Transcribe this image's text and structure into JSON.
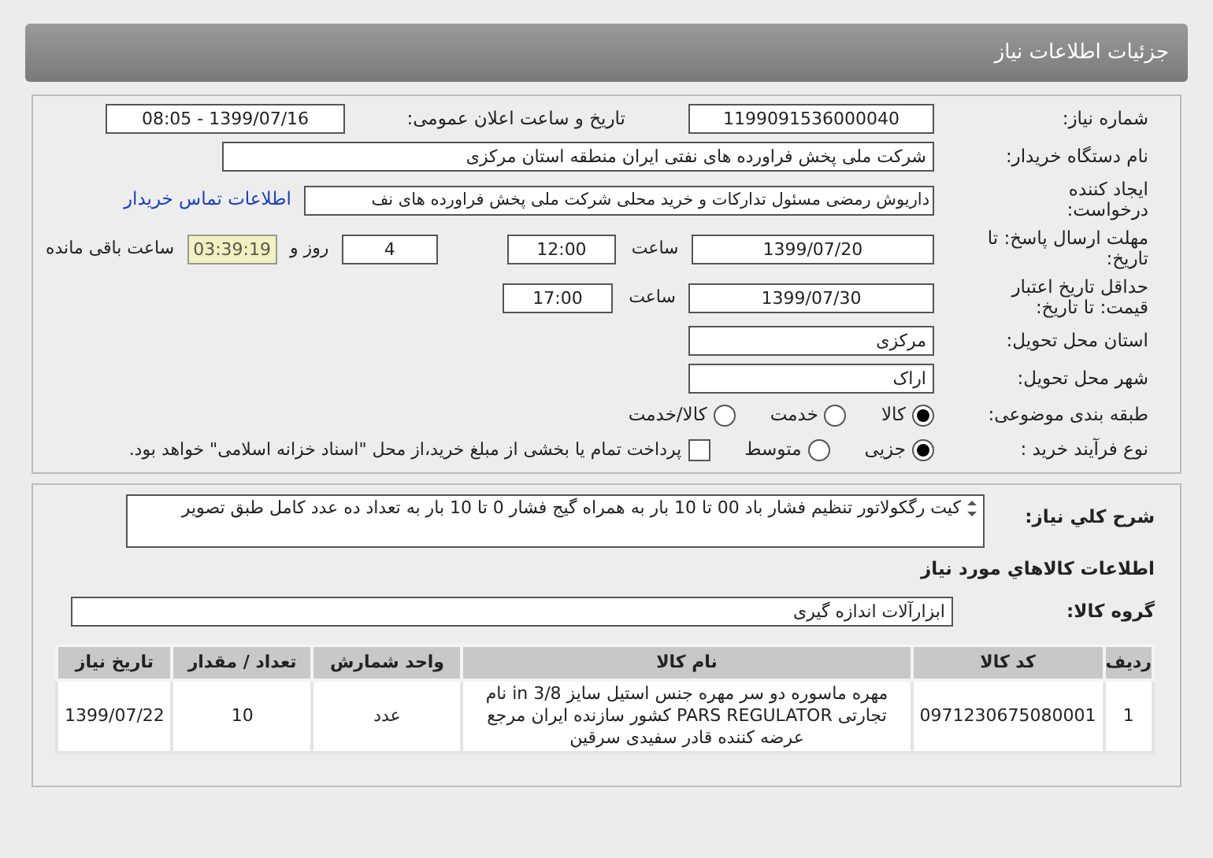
{
  "header": {
    "title": "جزئیات اطلاعات نیاز"
  },
  "need_number": {
    "label": "شماره نیاز:",
    "value": "1199091536000040"
  },
  "announce": {
    "label": "تاریخ و ساعت اعلان عمومی:",
    "value": "1399/07/16 - 08:05"
  },
  "buyer": {
    "label": "نام دستگاه خریدار:",
    "value": "شرکت ملی پخش فراورده های نفتی ایران منطقه استان مرکزی"
  },
  "creator": {
    "label": "ایجاد کننده درخواست:",
    "value": "داریوش رمضی مسئول تدارکات و خرید محلی شرکت ملی پخش فراورده های نف",
    "link": "اطلاعات تماس خریدار"
  },
  "deadline": {
    "label": "مهلت ارسال پاسخ: تا تاریخ:",
    "date": "1399/07/20",
    "time_label": "ساعت",
    "time": "12:00",
    "days": "4",
    "days_label": "روز و",
    "remaining": "03:39:19",
    "remaining_label": "ساعت باقی مانده"
  },
  "validity": {
    "label": "حداقل تاریخ اعتبار قیمت: تا تاریخ:",
    "date": "1399/07/30",
    "time_label": "ساعت",
    "time": "17:00"
  },
  "province": {
    "label": "استان محل تحویل:",
    "value": "مرکزی"
  },
  "city": {
    "label": "شهر محل تحویل:",
    "value": "اراک"
  },
  "category": {
    "label": "طبقه بندی موضوعی:",
    "options": [
      {
        "label": "کالا",
        "selected": true
      },
      {
        "label": "خدمت",
        "selected": false
      },
      {
        "label": "کالا/خدمت",
        "selected": false
      }
    ]
  },
  "process": {
    "label": "نوع فرآیند خرید :",
    "options": [
      {
        "label": "جزیی",
        "selected": true
      },
      {
        "label": "متوسط",
        "selected": false
      }
    ],
    "payment": {
      "label": "پرداخت تمام یا بخشی از مبلغ خرید،از محل \"اسناد خزانه اسلامی\" خواهد بود.",
      "checked": false
    }
  },
  "description": {
    "label": "شرح کلي نياز:",
    "value": "کیت رگکولاتور تنظیم فشار باد 00  تا  10 بار به همراه گیج فشار 0 تا   10  بار به تعداد ده عدد کامل طبق تصویر"
  },
  "goods_title": "اطلاعات کالاهاي مورد نياز",
  "group": {
    "label": "گروه کالا:",
    "value": "ابزارآلات اندازه گیری"
  },
  "table": {
    "columns": [
      "ردیف",
      "کد کالا",
      "نام کالا",
      "واحد شمارش",
      "تعداد / مقدار",
      "تاریخ نیاز"
    ],
    "rows": [
      [
        "1",
        "0971230675080001",
        "مهره ماسوره دو سر مهره جنس استیل سایز 3/8 in نام تجارتی PARS REGULATOR کشور سازنده ایران مرجع عرضه کننده قادر سفیدی سرقین",
        "عدد",
        "10",
        "1399/07/22"
      ]
    ]
  }
}
